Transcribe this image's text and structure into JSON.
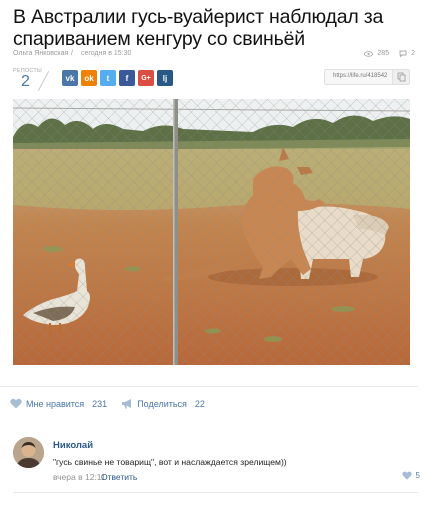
{
  "article": {
    "title": "В Австралии гусь-вуайерист наблюдал за спариванием кенгуру со свиньёй",
    "author": "Ольга Янковская",
    "separator": "/",
    "date": "сегодня в 15:30",
    "views": "285",
    "comments_count": "2"
  },
  "share": {
    "reposts_label": "РЕПОСТЫ",
    "reposts_count": "2",
    "buttons": [
      {
        "icon": "vk-icon",
        "glyph": "vk",
        "color": "#4a76a8"
      },
      {
        "icon": "odnoklassniki-icon",
        "glyph": "ok",
        "color": "#ee8208"
      },
      {
        "icon": "twitter-icon",
        "glyph": "t",
        "color": "#55acee"
      },
      {
        "icon": "facebook-icon",
        "glyph": "f",
        "color": "#3b5998"
      },
      {
        "icon": "google-plus-icon",
        "glyph": "G+",
        "color": "#dc4e41"
      },
      {
        "icon": "livejournal-icon",
        "glyph": "lj",
        "color": "#2a5885"
      }
    ],
    "short_link": "https://life.ru/418542"
  },
  "post_actions": {
    "like_label": "Мне нравится",
    "like_count": "231",
    "share_label": "Поделиться",
    "share_count": "22"
  },
  "comment": {
    "author": "Николай",
    "text": "\"гусь свинье не товарищ\", вот и наслаждается зрелищем))",
    "time": "вчера в 12:11",
    "reply_label": "Ответить",
    "likes": "5"
  },
  "colors": {
    "link_blue": "#2a5885",
    "accent_blue": "#4a76a8",
    "muted_gray": "#939393"
  }
}
